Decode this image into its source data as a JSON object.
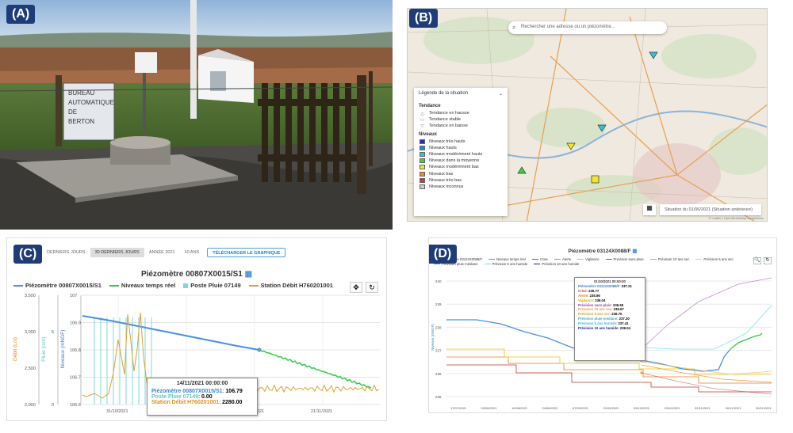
{
  "panels": {
    "a": {
      "label": "(A)"
    },
    "b": {
      "label": "(B)"
    },
    "c": {
      "label": "(C)"
    },
    "d": {
      "label": "(D)"
    }
  },
  "photo": {
    "sign_lines": [
      "BUREAU",
      "AUTOMATIQUE",
      "DE",
      "BERTON"
    ]
  },
  "map": {
    "search_placeholder": "Rechercher une adresse ou un piézomètre...",
    "legend_title": "Légende de la situation",
    "tendance_title": "Tendance",
    "tendance_items": [
      {
        "symbol": "△",
        "label": "Tendance en hausse"
      },
      {
        "symbol": "▭",
        "label": "Tendance stable"
      },
      {
        "symbol": "▽",
        "label": "Tendance en baisse"
      }
    ],
    "niveaux_title": "Niveaux",
    "niveaux_items": [
      {
        "color": "#1f2fc8",
        "label": "Niveaux très hauts"
      },
      {
        "color": "#1e88e5",
        "label": "Niveaux hauts"
      },
      {
        "color": "#2ec4d6",
        "label": "Niveaux modérément hauts"
      },
      {
        "color": "#3ccf3c",
        "label": "Niveaux dans la moyenne"
      },
      {
        "color": "#f3e52a",
        "label": "Niveaux modérément bas"
      },
      {
        "color": "#f08a1c",
        "label": "Niveaux bas"
      },
      {
        "color": "#e3301f",
        "label": "Niveaux très bas"
      },
      {
        "color": "#cccccc",
        "label": "Niveaux inconnus"
      }
    ],
    "situation": "Situation du 01/06/2021 (Situation antérieure)",
    "attribution": "© Leaflet | OpenStreetMap contributors"
  },
  "panel_c": {
    "tabs": [
      {
        "label": "DERNIERS JOURS",
        "active": false
      },
      {
        "label": "30 DERNIERS JOURS",
        "active": true
      },
      {
        "label": "ANNÉE 2021",
        "active": false
      },
      {
        "label": "10 ANS",
        "active": false
      }
    ],
    "download_label": "TÉLÉCHARGER LE GRAPHIQUE",
    "title": "Piézomètre 00807X0015/S1",
    "legend": [
      {
        "label": "Piézomètre 00807X0015/S1",
        "color": "#4a90e2",
        "kind": "line"
      },
      {
        "label": "Niveaux temps réel",
        "color": "#2ecc40",
        "kind": "line"
      },
      {
        "label": "Poste Pluie 07149",
        "color": "#7fd8d8",
        "kind": "square"
      },
      {
        "label": "Station Débit H760201001",
        "color": "#e0a030",
        "kind": "line"
      }
    ],
    "tools": [
      "✥",
      "↻"
    ],
    "tooltip": {
      "header": "14/11/2021 00:00:00",
      "rows": [
        {
          "name": "Piézomètre 00807X0015/S1",
          "value": "106.79",
          "color": "#3a7fd0"
        },
        {
          "name": "Poste Pluie 07149",
          "value": "0.00",
          "color": "#5ac8c8"
        },
        {
          "name": "Station Débit H760201001",
          "value": "2280.00",
          "color": "#d89020"
        }
      ]
    },
    "axis_debit": {
      "label": "Débit (L/s)",
      "ticks": [
        "3,500",
        "3,000",
        "2,500",
        "2,000"
      ]
    },
    "axis_pluie": {
      "label": "Pluie (mm)",
      "ticks": [
        "5",
        "0"
      ]
    },
    "axis_niveaux": {
      "label": "Niveaux (mNGF)",
      "ticks": [
        "107",
        "106.9",
        "106.8",
        "106.7",
        "106.6"
      ]
    },
    "x_ticks": [
      "31/10/2021",
      "07/11/2021",
      "14/11/2021",
      "21/11/2021"
    ]
  },
  "panel_d": {
    "title": "Piézomètre 03124X0088/F",
    "legend": [
      {
        "label": "Piézomètre 03124X0088/F",
        "color": "#4a90e2"
      },
      {
        "label": "Niveaux temps réel",
        "color": "#2ecc40"
      },
      {
        "label": "Crise",
        "color": "#c0392b"
      },
      {
        "label": "Alerte",
        "color": "#e67e22"
      },
      {
        "label": "Vigilance",
        "color": "#f1c40f"
      },
      {
        "label": "Prévision sans pluie",
        "color": "#8e44ad"
      },
      {
        "label": "Prévision 10 ans sec",
        "color": "#e6a23c"
      },
      {
        "label": "Prévision 5 ans sec",
        "color": "#f5c96a"
      },
      {
        "label": "Prévision pluie médiane",
        "color": "#3ab0c0"
      },
      {
        "label": "Prévision 5 ans humide",
        "color": "#7fdfff"
      },
      {
        "label": "Prévision 10 ans humide",
        "color": "#1a237e"
      }
    ],
    "tools": [
      "🔍",
      "↻"
    ],
    "tooltip": {
      "header": "01/10/2021 00:00:00",
      "rows": [
        {
          "name": "Piézomètre 03124X0088/F",
          "value": "237.21",
          "color": "#3a7fd0"
        },
        {
          "name": "Crise",
          "value": "235.77",
          "color": "#c0392b"
        },
        {
          "name": "Alerte",
          "value": "235.96",
          "color": "#e67e22"
        },
        {
          "name": "Vigilance",
          "value": "236.04",
          "color": "#d4a800"
        },
        {
          "name": "Prévision sans pluie",
          "value": "236.65",
          "color": "#8e44ad"
        },
        {
          "name": "Prévision 10 ans sec",
          "value": "236.67",
          "color": "#e6a23c"
        },
        {
          "name": "Prévision 5 ans sec",
          "value": "236.70",
          "color": "#d4a040"
        },
        {
          "name": "Prévision pluie médiane",
          "value": "237.30",
          "color": "#3ab0c0"
        },
        {
          "name": "Prévision 5 ans humide",
          "value": "237.41",
          "color": "#33b6e0"
        },
        {
          "name": "Prévision 10 ans humide",
          "value": "238.04",
          "color": "#1a237e"
        }
      ]
    },
    "y_label": "Niveaux (mNGF)",
    "y_ticks": [
      "240",
      "239",
      "238",
      "237",
      "236",
      "235"
    ],
    "x_ticks": [
      "17/07/2021",
      "03/08/2021",
      "10/08/2021",
      "24/08/2021",
      "07/09/2021",
      "21/09/2021",
      "05/10/2021",
      "19/10/2021",
      "02/11/2021",
      "16/11/2021",
      "30/11/2021"
    ]
  }
}
